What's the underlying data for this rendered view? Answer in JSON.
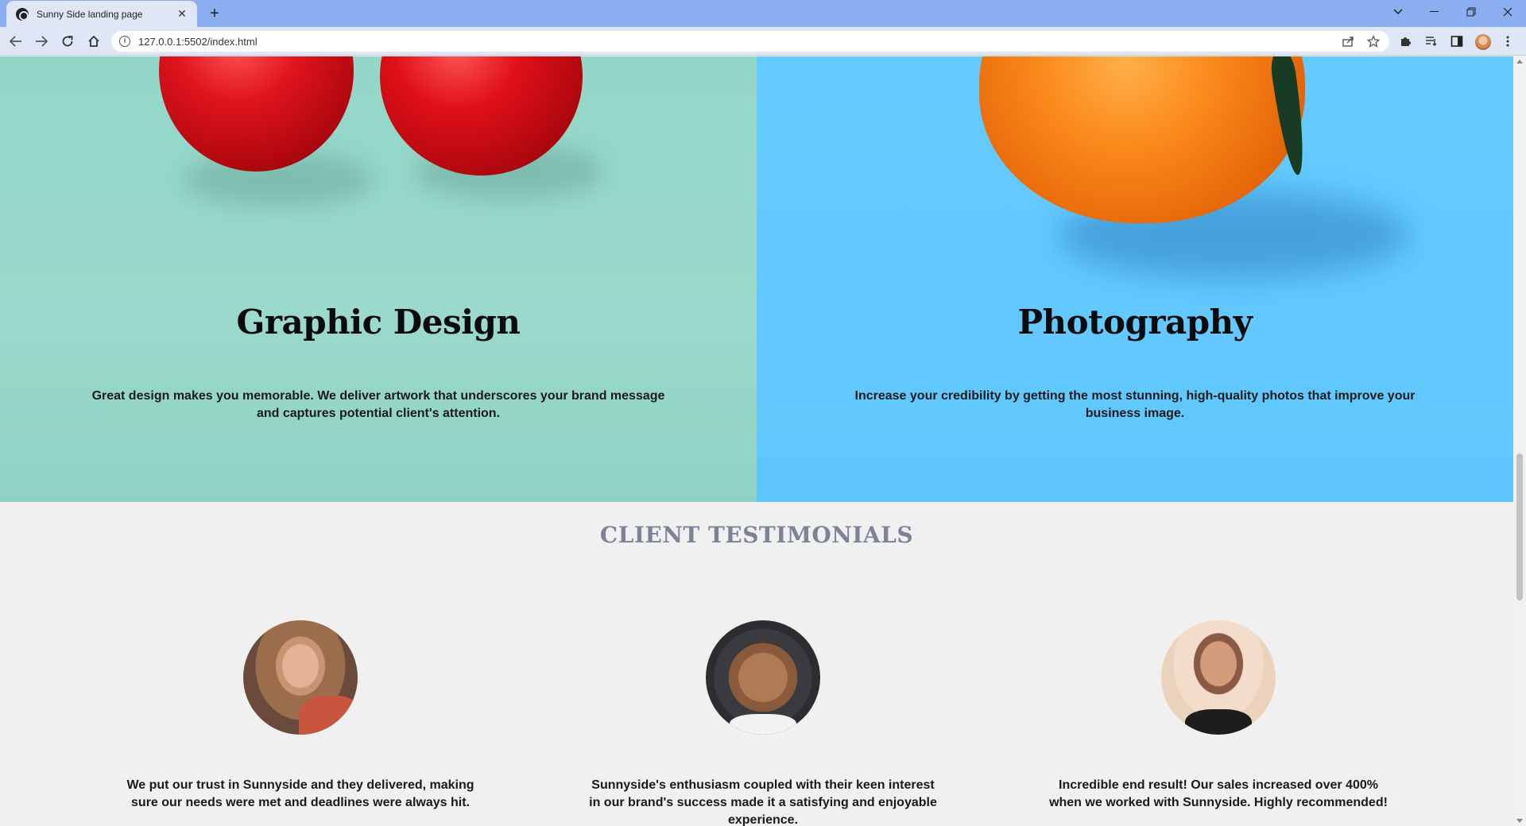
{
  "browser": {
    "tab_title": "Sunny Side landing page",
    "tab_close": "✕",
    "new_tab": "+",
    "url": "127.0.0.1:5502/index.html"
  },
  "features": [
    {
      "title": "Graphic Design",
      "text": "Great design makes you memorable. We deliver artwork that underscores your brand message and captures potential client's attention."
    },
    {
      "title": "Photography",
      "text": "Increase your credibility by getting the most stunning, high-quality photos that improve your business image."
    }
  ],
  "testimonials": {
    "heading": "CLIENT TESTIMONIALS",
    "items": [
      {
        "quote": "We put our trust in Sunnyside and they delivered, making sure our needs were met and deadlines were always hit."
      },
      {
        "quote": "Sunnyside's enthusiasm coupled with their keen interest in our brand's success made it a satisfying and enjoyable experience."
      },
      {
        "quote": "Incredible end result! Our sales increased over 400% when we worked with Sunnyside. Highly recommended!"
      }
    ]
  }
}
